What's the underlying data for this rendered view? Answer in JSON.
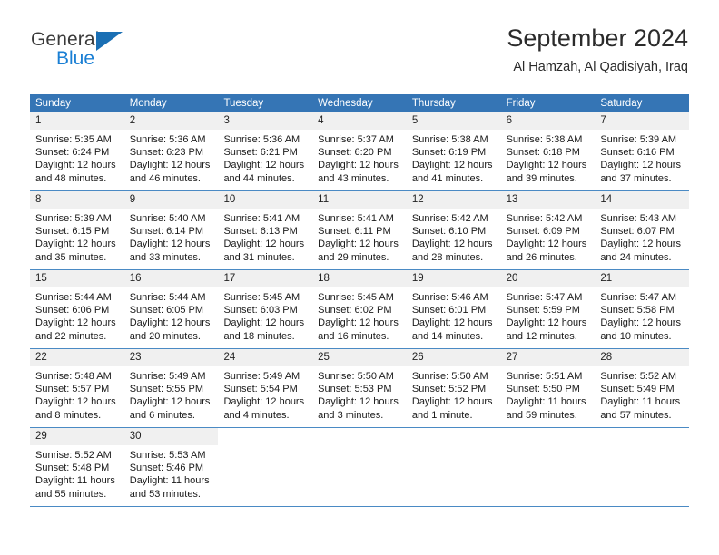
{
  "brand": {
    "name_part1": "General",
    "name_part2": "Blue",
    "triangle_color": "#1a6fb4",
    "blue_color": "#1a7fd4"
  },
  "header": {
    "title": "September 2024",
    "subtitle": "Al Hamzah, Al Qadisiyah, Iraq"
  },
  "colors": {
    "header_row_bg": "#3575b5",
    "daynum_band_bg": "#f0f0f0",
    "week_divider": "#4a8ac4"
  },
  "calendar": {
    "weekday_headers": [
      "Sunday",
      "Monday",
      "Tuesday",
      "Wednesday",
      "Thursday",
      "Friday",
      "Saturday"
    ],
    "weeks": [
      [
        {
          "day": "1",
          "sunrise": "Sunrise: 5:35 AM",
          "sunset": "Sunset: 6:24 PM",
          "daylight1": "Daylight: 12 hours",
          "daylight2": "and 48 minutes."
        },
        {
          "day": "2",
          "sunrise": "Sunrise: 5:36 AM",
          "sunset": "Sunset: 6:23 PM",
          "daylight1": "Daylight: 12 hours",
          "daylight2": "and 46 minutes."
        },
        {
          "day": "3",
          "sunrise": "Sunrise: 5:36 AM",
          "sunset": "Sunset: 6:21 PM",
          "daylight1": "Daylight: 12 hours",
          "daylight2": "and 44 minutes."
        },
        {
          "day": "4",
          "sunrise": "Sunrise: 5:37 AM",
          "sunset": "Sunset: 6:20 PM",
          "daylight1": "Daylight: 12 hours",
          "daylight2": "and 43 minutes."
        },
        {
          "day": "5",
          "sunrise": "Sunrise: 5:38 AM",
          "sunset": "Sunset: 6:19 PM",
          "daylight1": "Daylight: 12 hours",
          "daylight2": "and 41 minutes."
        },
        {
          "day": "6",
          "sunrise": "Sunrise: 5:38 AM",
          "sunset": "Sunset: 6:18 PM",
          "daylight1": "Daylight: 12 hours",
          "daylight2": "and 39 minutes."
        },
        {
          "day": "7",
          "sunrise": "Sunrise: 5:39 AM",
          "sunset": "Sunset: 6:16 PM",
          "daylight1": "Daylight: 12 hours",
          "daylight2": "and 37 minutes."
        }
      ],
      [
        {
          "day": "8",
          "sunrise": "Sunrise: 5:39 AM",
          "sunset": "Sunset: 6:15 PM",
          "daylight1": "Daylight: 12 hours",
          "daylight2": "and 35 minutes."
        },
        {
          "day": "9",
          "sunrise": "Sunrise: 5:40 AM",
          "sunset": "Sunset: 6:14 PM",
          "daylight1": "Daylight: 12 hours",
          "daylight2": "and 33 minutes."
        },
        {
          "day": "10",
          "sunrise": "Sunrise: 5:41 AM",
          "sunset": "Sunset: 6:13 PM",
          "daylight1": "Daylight: 12 hours",
          "daylight2": "and 31 minutes."
        },
        {
          "day": "11",
          "sunrise": "Sunrise: 5:41 AM",
          "sunset": "Sunset: 6:11 PM",
          "daylight1": "Daylight: 12 hours",
          "daylight2": "and 29 minutes."
        },
        {
          "day": "12",
          "sunrise": "Sunrise: 5:42 AM",
          "sunset": "Sunset: 6:10 PM",
          "daylight1": "Daylight: 12 hours",
          "daylight2": "and 28 minutes."
        },
        {
          "day": "13",
          "sunrise": "Sunrise: 5:42 AM",
          "sunset": "Sunset: 6:09 PM",
          "daylight1": "Daylight: 12 hours",
          "daylight2": "and 26 minutes."
        },
        {
          "day": "14",
          "sunrise": "Sunrise: 5:43 AM",
          "sunset": "Sunset: 6:07 PM",
          "daylight1": "Daylight: 12 hours",
          "daylight2": "and 24 minutes."
        }
      ],
      [
        {
          "day": "15",
          "sunrise": "Sunrise: 5:44 AM",
          "sunset": "Sunset: 6:06 PM",
          "daylight1": "Daylight: 12 hours",
          "daylight2": "and 22 minutes."
        },
        {
          "day": "16",
          "sunrise": "Sunrise: 5:44 AM",
          "sunset": "Sunset: 6:05 PM",
          "daylight1": "Daylight: 12 hours",
          "daylight2": "and 20 minutes."
        },
        {
          "day": "17",
          "sunrise": "Sunrise: 5:45 AM",
          "sunset": "Sunset: 6:03 PM",
          "daylight1": "Daylight: 12 hours",
          "daylight2": "and 18 minutes."
        },
        {
          "day": "18",
          "sunrise": "Sunrise: 5:45 AM",
          "sunset": "Sunset: 6:02 PM",
          "daylight1": "Daylight: 12 hours",
          "daylight2": "and 16 minutes."
        },
        {
          "day": "19",
          "sunrise": "Sunrise: 5:46 AM",
          "sunset": "Sunset: 6:01 PM",
          "daylight1": "Daylight: 12 hours",
          "daylight2": "and 14 minutes."
        },
        {
          "day": "20",
          "sunrise": "Sunrise: 5:47 AM",
          "sunset": "Sunset: 5:59 PM",
          "daylight1": "Daylight: 12 hours",
          "daylight2": "and 12 minutes."
        },
        {
          "day": "21",
          "sunrise": "Sunrise: 5:47 AM",
          "sunset": "Sunset: 5:58 PM",
          "daylight1": "Daylight: 12 hours",
          "daylight2": "and 10 minutes."
        }
      ],
      [
        {
          "day": "22",
          "sunrise": "Sunrise: 5:48 AM",
          "sunset": "Sunset: 5:57 PM",
          "daylight1": "Daylight: 12 hours",
          "daylight2": "and 8 minutes."
        },
        {
          "day": "23",
          "sunrise": "Sunrise: 5:49 AM",
          "sunset": "Sunset: 5:55 PM",
          "daylight1": "Daylight: 12 hours",
          "daylight2": "and 6 minutes."
        },
        {
          "day": "24",
          "sunrise": "Sunrise: 5:49 AM",
          "sunset": "Sunset: 5:54 PM",
          "daylight1": "Daylight: 12 hours",
          "daylight2": "and 4 minutes."
        },
        {
          "day": "25",
          "sunrise": "Sunrise: 5:50 AM",
          "sunset": "Sunset: 5:53 PM",
          "daylight1": "Daylight: 12 hours",
          "daylight2": "and 3 minutes."
        },
        {
          "day": "26",
          "sunrise": "Sunrise: 5:50 AM",
          "sunset": "Sunset: 5:52 PM",
          "daylight1": "Daylight: 12 hours",
          "daylight2": "and 1 minute."
        },
        {
          "day": "27",
          "sunrise": "Sunrise: 5:51 AM",
          "sunset": "Sunset: 5:50 PM",
          "daylight1": "Daylight: 11 hours",
          "daylight2": "and 59 minutes."
        },
        {
          "day": "28",
          "sunrise": "Sunrise: 5:52 AM",
          "sunset": "Sunset: 5:49 PM",
          "daylight1": "Daylight: 11 hours",
          "daylight2": "and 57 minutes."
        }
      ],
      [
        {
          "day": "29",
          "sunrise": "Sunrise: 5:52 AM",
          "sunset": "Sunset: 5:48 PM",
          "daylight1": "Daylight: 11 hours",
          "daylight2": "and 55 minutes."
        },
        {
          "day": "30",
          "sunrise": "Sunrise: 5:53 AM",
          "sunset": "Sunset: 5:46 PM",
          "daylight1": "Daylight: 11 hours",
          "daylight2": "and 53 minutes."
        },
        {
          "day": "",
          "sunrise": "",
          "sunset": "",
          "daylight1": "",
          "daylight2": ""
        },
        {
          "day": "",
          "sunrise": "",
          "sunset": "",
          "daylight1": "",
          "daylight2": ""
        },
        {
          "day": "",
          "sunrise": "",
          "sunset": "",
          "daylight1": "",
          "daylight2": ""
        },
        {
          "day": "",
          "sunrise": "",
          "sunset": "",
          "daylight1": "",
          "daylight2": ""
        },
        {
          "day": "",
          "sunrise": "",
          "sunset": "",
          "daylight1": "",
          "daylight2": ""
        }
      ]
    ]
  }
}
